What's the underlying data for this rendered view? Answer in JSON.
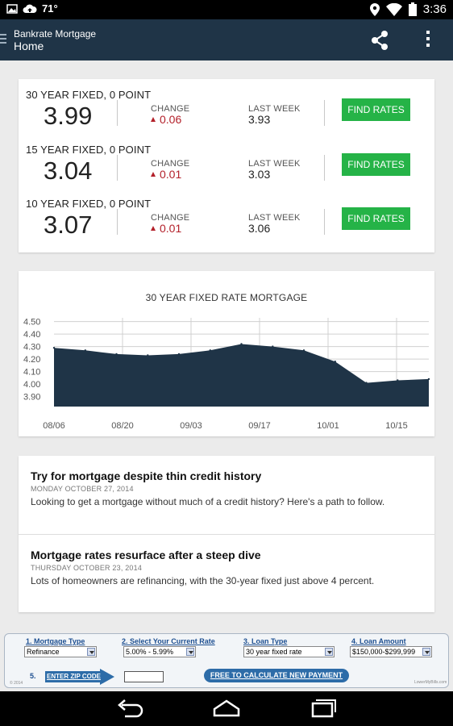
{
  "status_bar": {
    "temperature": "71°",
    "time": "3:36",
    "icons": [
      "image-icon",
      "cloud-upload-icon",
      "location-icon",
      "wifi-icon",
      "battery-icon"
    ]
  },
  "action_bar": {
    "app_name": "Bankrate Mortgage",
    "screen_title": "Home",
    "icons": [
      "menu-icon",
      "share-icon",
      "overflow-menu-icon"
    ]
  },
  "rates": {
    "change_label": "CHANGE",
    "last_week_label": "LAST WEEK",
    "button_label": "FIND RATES",
    "items": [
      {
        "name": "30 YEAR FIXED, 0 POINT",
        "value": "3.99",
        "change": "0.06",
        "last_week": "3.93"
      },
      {
        "name": "15 YEAR FIXED, 0 POINT",
        "value": "3.04",
        "change": "0.01",
        "last_week": "3.03"
      },
      {
        "name": "10 YEAR FIXED, 0 POINT",
        "value": "3.07",
        "change": "0.01",
        "last_week": "3.06"
      }
    ],
    "change_color": "#b3202a",
    "button_color": "#25b347"
  },
  "chart_data": {
    "type": "area",
    "title": "30 YEAR FIXED RATE MORTGAGE",
    "xlabel": "",
    "ylabel": "",
    "x_tick_labels": [
      "08/06",
      "08/20",
      "09/03",
      "09/17",
      "10/01",
      "10/15"
    ],
    "y_tick_labels": [
      "4.50",
      "4.40",
      "4.30",
      "4.20",
      "4.10",
      "4.00",
      "3.90"
    ],
    "ylim": [
      3.82,
      4.53
    ],
    "grid": true,
    "fill_color": "#1f3447",
    "series": [
      {
        "x": [
          "07/31",
          "08/07",
          "08/14",
          "08/21",
          "08/28",
          "09/04",
          "09/11",
          "09/18",
          "09/25",
          "10/02",
          "10/09",
          "10/16",
          "10/23"
        ],
        "values": [
          4.29,
          4.27,
          4.24,
          4.23,
          4.24,
          4.27,
          4.32,
          4.3,
          4.27,
          4.18,
          4.01,
          4.03,
          4.04
        ]
      }
    ]
  },
  "news": [
    {
      "title": "Try for mortgage despite thin credit history",
      "date": "MONDAY OCTOBER 27, 2014",
      "summary": "Looking to get a mortgage without much of a credit history? Here's a path to follow."
    },
    {
      "title": "Mortgage rates resurface after a steep dive",
      "date": "THURSDAY OCTOBER 23, 2014",
      "summary": "Lots of homeowners are refinancing, with the 30-year fixed just above 4 percent."
    }
  ],
  "ad": {
    "step1_label": "1. Mortgage Type",
    "step1_value": "Refinance",
    "step2_label": "2. Select Your Current Rate",
    "step2_value": "5.00% - 5.99%",
    "step3_label": "3. Loan Type",
    "step3_value": "30 year fixed rate",
    "step4_label": "4. Loan Amount",
    "step4_value": "$150,000-$299,999",
    "step5_label": "5.",
    "zip_label": "ENTER ZIP CODE",
    "calc_button": "FREE TO CALCULATE NEW PAYMENT",
    "copyright": "© 2014",
    "brand": "LowerMyBills.com"
  },
  "nav_bar": {
    "icons": [
      "back-icon",
      "home-icon",
      "recent-apps-icon"
    ]
  }
}
